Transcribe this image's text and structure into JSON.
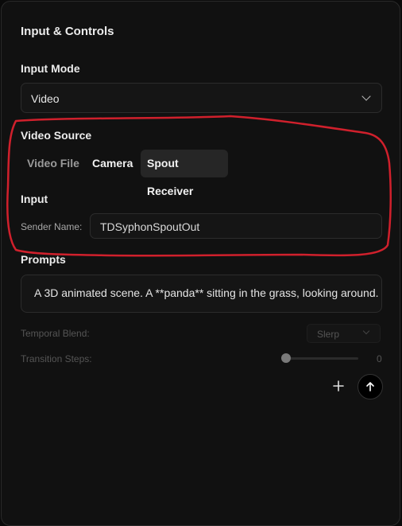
{
  "panel": {
    "title": "Input & Controls"
  },
  "input_mode": {
    "label": "Input Mode",
    "selected": "Video"
  },
  "video_source": {
    "label": "Video Source",
    "tabs": [
      {
        "label": "Video File",
        "active": false
      },
      {
        "label": "Camera",
        "active": false
      },
      {
        "label": "Spout Receiver",
        "active": true
      }
    ]
  },
  "input": {
    "label": "Input",
    "sender_name_label": "Sender Name:",
    "sender_name_value": "TDSyphonSpoutOut"
  },
  "prompts": {
    "label": "Prompts",
    "text": "A 3D animated scene. A **panda** sitting in the grass, looking around."
  },
  "temporal_blend": {
    "label": "Temporal Blend:",
    "selected": "Slerp"
  },
  "transition_steps": {
    "label": "Transition Steps:",
    "value": "0"
  },
  "actions": {
    "add_icon": "plus-icon",
    "send_icon": "arrow-up-icon"
  },
  "colors": {
    "annotation": "#d0202c",
    "background": "#111111"
  }
}
